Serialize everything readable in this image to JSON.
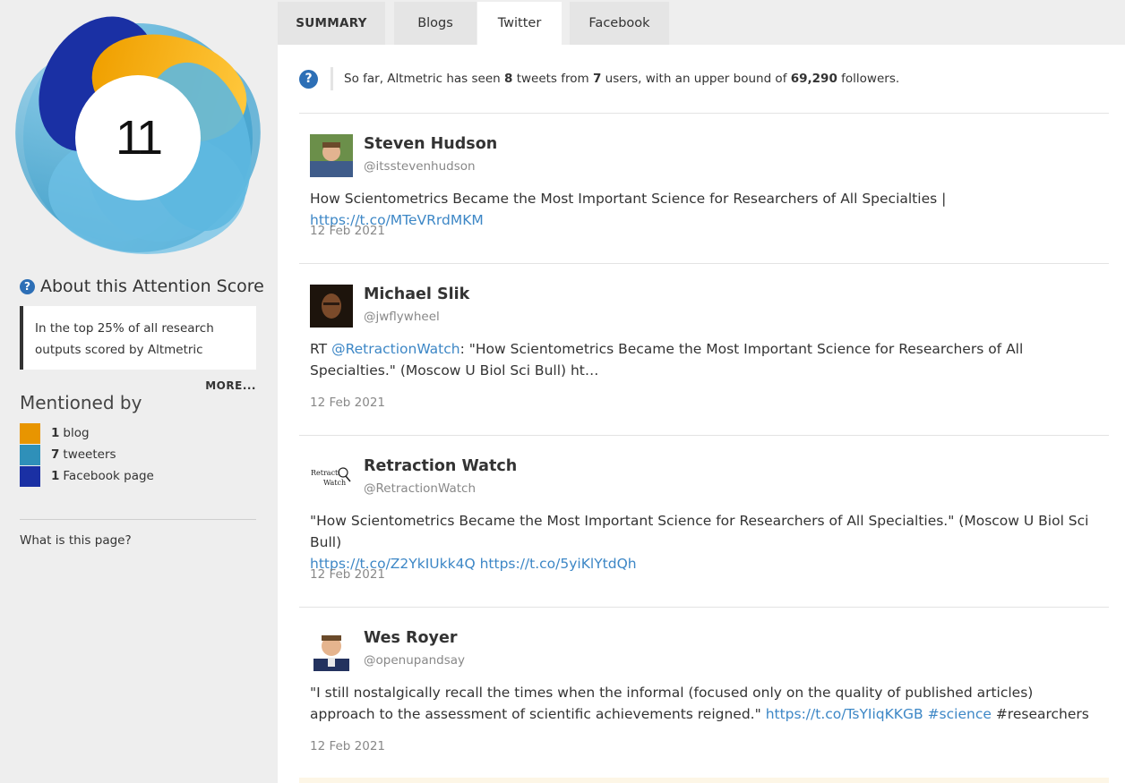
{
  "score": {
    "value": "11",
    "about_title": "About this Attention Score",
    "about_text": "In the top 25% of all research outputs scored by Altmetric",
    "more_label": "MORE..."
  },
  "mentioned": {
    "title": "Mentioned by",
    "items": [
      {
        "count": "1",
        "label": "blog",
        "color": "#e89500"
      },
      {
        "count": "7",
        "label": "tweeters",
        "color": "#2f90b9"
      },
      {
        "count": "1",
        "label": "Facebook page",
        "color": "#1a30a4"
      }
    ],
    "what_label": "What is this page?"
  },
  "tabs": [
    {
      "label": "SUMMARY"
    },
    {
      "label": "Blogs"
    },
    {
      "label": "Twitter"
    },
    {
      "label": "Facebook"
    }
  ],
  "info": {
    "prefix": "So far, Altmetric has seen",
    "tweets": "8",
    "middle1": "tweets from",
    "users": "7",
    "middle2": "users, with an upper bound of",
    "followers": "69,290",
    "suffix": "followers."
  },
  "tweets": [
    {
      "name": "Steven Hudson",
      "handle": "@itsstevenhudson",
      "text": "How Scientometrics Became the Most Important Science for Researchers of All Specialties |",
      "link1": "https://t.co/MTeVRrdMKM",
      "date": "12 Feb 2021"
    },
    {
      "name": "Michael Slik",
      "handle": "@jwflywheel",
      "prefix": "RT",
      "mention": "@RetractionWatch",
      "text": ": \"How Scientometrics Became the Most Important Science for Researchers of All Specialties.\" (Moscow U Biol Sci Bull) ht…",
      "date": "12 Feb 2021"
    },
    {
      "name": "Retraction Watch",
      "handle": "@RetractionWatch",
      "logo_text": "Retraction Watch",
      "text": "\"How Scientometrics Became the Most Important Science for Researchers of All Specialties.\" (Moscow U Biol Sci Bull)",
      "link1": "https://t.co/Z2YkIUkk4Q",
      "link2": "https://t.co/5yiKlYtdQh",
      "date": "12 Feb 2021"
    },
    {
      "name": "Wes Royer",
      "handle": "@openupandsay",
      "text": "\"I still nostalgically recall the times when the informal (focused only on the quality of published articles) approach to the assessment of scientific achievements reigned.\"",
      "link1": "https://t.co/TsYIiqKKGB",
      "hashtag": "#science",
      "suffix": "#researchers",
      "date": "12 Feb 2021"
    }
  ]
}
